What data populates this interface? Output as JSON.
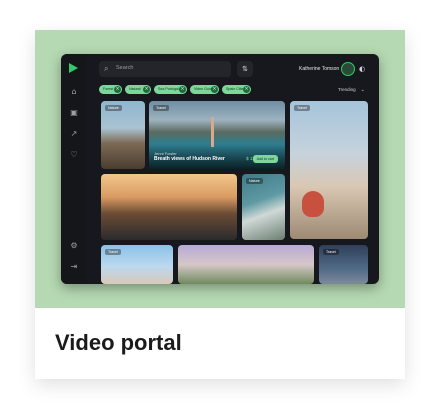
{
  "card": {
    "title": "Video portal",
    "colors": {
      "hero_bg": "#b5d9b2",
      "accent": "#2ecc6b"
    }
  },
  "app": {
    "search_placeholder": "Search",
    "filter_icon": "sliders-icon",
    "user_name": "Katherine Tomson",
    "sort_label": "Trending",
    "chips": [
      "Forest",
      "Natural",
      "Sea Portugal",
      "Video Guide",
      "Spain Cities"
    ],
    "rail_icons": [
      "home-icon",
      "calendar-icon",
      "share-icon",
      "heart-icon",
      "settings-icon",
      "logout-icon"
    ],
    "featured": {
      "tag": "Travel",
      "title": "Jenni Fowler",
      "subtitle": "Breath views of Hudson River",
      "price": "$ 110",
      "action": "Add to cart"
    },
    "tiles": [
      "Nature",
      "Travel",
      "Nature",
      "Travel",
      "Travel"
    ]
  }
}
